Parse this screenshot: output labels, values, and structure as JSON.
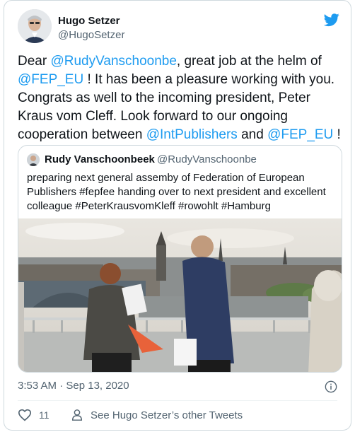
{
  "author": {
    "name": "Hugo Setzer",
    "handle": "@HugoSetzer"
  },
  "tweet": {
    "t1": "Dear ",
    "m1": "@RudyVanschoonbe",
    "t2": ", great job at the helm of ",
    "m2": "@FEP_EU",
    "t3": " ! It has been a pleasure working with you. Congrats as well to the incoming president, Peter Kraus vom Cleff. Look forward to our ongoing cooperation between ",
    "m3": "@IntPublishers",
    "t4": " and ",
    "m4": "@FEP_EU",
    "t5": " !"
  },
  "quote": {
    "name": "Rudy Vanschoonbeek",
    "handle": "@RudyVanschoonbe",
    "text": "preparing next general assemby of Federation of European Publishers #fepfee handing over to next president and excellent colleague #PeterKrausvomKleff  #rowohlt #Hamburg"
  },
  "footer": {
    "timestamp": "3:53 AM · Sep 13, 2020",
    "likes": "11",
    "other_tweets": "See Hugo Setzer’s other Tweets"
  },
  "colors": {
    "accent": "#1d9bf0",
    "secondary_text": "#536471"
  }
}
